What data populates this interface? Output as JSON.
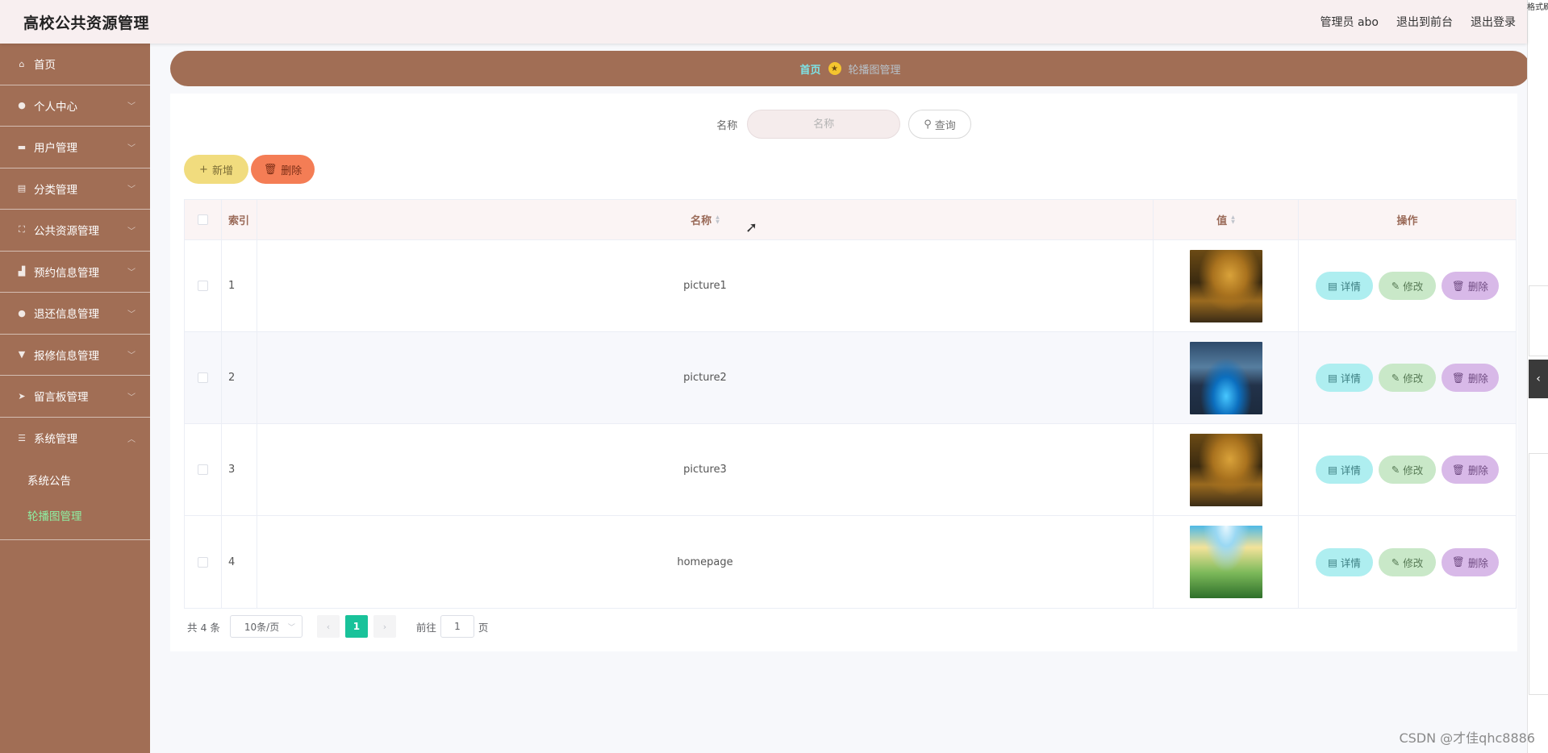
{
  "header": {
    "title": "高校公共资源管理",
    "admin_label": "管理员 abo",
    "front_label": "退出到前台",
    "logout_label": "退出登录"
  },
  "sidebar": {
    "items": [
      {
        "label": "首页",
        "icon": "home-icon"
      },
      {
        "label": "个人中心",
        "icon": "user-icon"
      },
      {
        "label": "用户管理",
        "icon": "users-icon"
      },
      {
        "label": "分类管理",
        "icon": "category-icon"
      },
      {
        "label": "公共资源管理",
        "icon": "resource-icon"
      },
      {
        "label": "预约信息管理",
        "icon": "booking-icon"
      },
      {
        "label": "退还信息管理",
        "icon": "return-icon"
      },
      {
        "label": "报修信息管理",
        "icon": "repair-icon"
      },
      {
        "label": "留言板管理",
        "icon": "message-icon"
      },
      {
        "label": "系统管理",
        "icon": "settings-icon"
      }
    ],
    "sub_items": [
      {
        "label": "系统公告"
      },
      {
        "label": "轮播图管理",
        "active": true
      }
    ]
  },
  "breadcrumb": {
    "home": "首页",
    "current": "轮播图管理"
  },
  "search": {
    "label": "名称",
    "placeholder": "名称",
    "button": "查询"
  },
  "actions": {
    "add": "新增",
    "delete": "删除"
  },
  "table": {
    "headers": {
      "index": "索引",
      "name": "名称",
      "value": "值",
      "ops": "操作"
    },
    "rows": [
      {
        "index": "1",
        "name": "picture1",
        "image": "dark-golden-city"
      },
      {
        "index": "2",
        "name": "picture2",
        "image": "night-bridge"
      },
      {
        "index": "3",
        "name": "picture3",
        "image": "dark-golden-city"
      },
      {
        "index": "4",
        "name": "homepage",
        "image": "sunny-landscape"
      }
    ],
    "op_labels": {
      "detail": "详情",
      "edit": "修改",
      "delete": "删除"
    }
  },
  "pagination": {
    "total": "共 4 条",
    "page_size": "10条/页",
    "current_page": "1",
    "goto_prefix": "前往",
    "goto_value": "1",
    "goto_suffix": "页"
  },
  "right_panel": {
    "text": "格式刷"
  },
  "watermark": "CSDN @才佳qhc8886",
  "colors": {
    "sidebar": "#a16e55",
    "header": "#f8eff0",
    "accent_green": "#19c29a",
    "add_button": "#f1dc7e",
    "delete_button": "#f47d55"
  }
}
